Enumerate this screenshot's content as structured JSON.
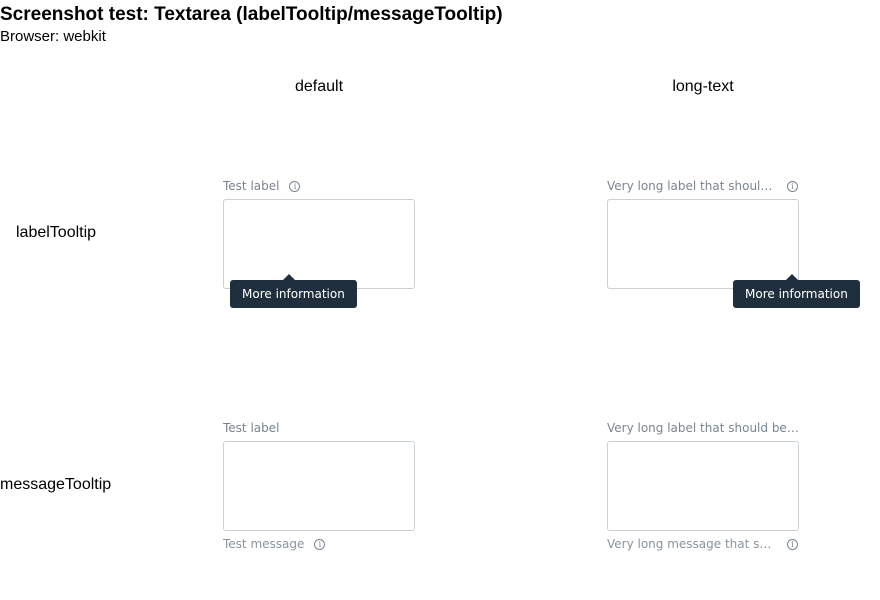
{
  "header": {
    "title": "Screenshot test: Textarea (labelTooltip/messageTooltip)",
    "browser": "Browser: webkit"
  },
  "columns": [
    "default",
    "long-text"
  ],
  "rows": [
    "labelTooltip",
    "messageTooltip"
  ],
  "cells": {
    "label_tooltip_default": {
      "label": "Test label",
      "value": "",
      "tooltip": "More information",
      "icon": "info-icon"
    },
    "label_tooltip_long": {
      "label": "Very long label that should be truncated",
      "value": "",
      "tooltip": "More information",
      "icon": "info-icon"
    },
    "message_tooltip_default": {
      "label": "Test label",
      "value": "",
      "message": "Test message",
      "icon": "info-icon"
    },
    "message_tooltip_long": {
      "label": "Very long label that should be truncated",
      "value": "",
      "message": "Very long message that should be truncated",
      "icon": "info-icon"
    }
  },
  "colors": {
    "tooltip_bg": "#1f2f3d",
    "label_text": "#7a8590",
    "textarea_border": "#c9d0d6"
  }
}
